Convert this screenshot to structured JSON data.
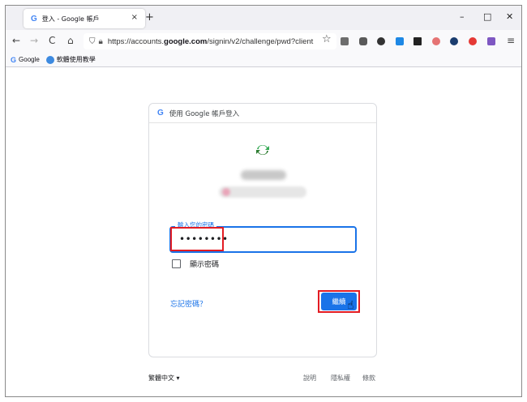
{
  "tab": {
    "title": "登入 - Google 帳戶",
    "favicon": "G",
    "close": "×"
  },
  "newtab": "+",
  "window_controls": {
    "minimize": "–",
    "maximize": "□",
    "close": "✕"
  },
  "nav": {
    "back": "←",
    "forward": "→",
    "reload": "C",
    "home": "⌂",
    "url_prefix": "https://accounts.",
    "url_domain": "google.com",
    "url_rest": "/signin/v2/challenge/pwd?client",
    "star": "☆",
    "menu": "≡"
  },
  "bookmarks": [
    {
      "icon": "google-icon",
      "label": "Google"
    },
    {
      "icon": "bookmark-globe-icon",
      "label": "軟體使用教學"
    }
  ],
  "card": {
    "header_icon": "G",
    "header_title": "使用 Google 帳戶登入",
    "password_label": "輸入您的密碼",
    "password_value": "••••••••",
    "show_password": "顯示密碼",
    "forgot_password": "忘記密碼？",
    "next_button": "繼續"
  },
  "footer": {
    "language": "繁體中文 ▾",
    "help": "說明",
    "privacy": "隱私權",
    "terms": "條款"
  },
  "colors": {
    "accent": "#1a73e8",
    "highlight_red": "#e31c23",
    "logo_green": "#34a853"
  }
}
